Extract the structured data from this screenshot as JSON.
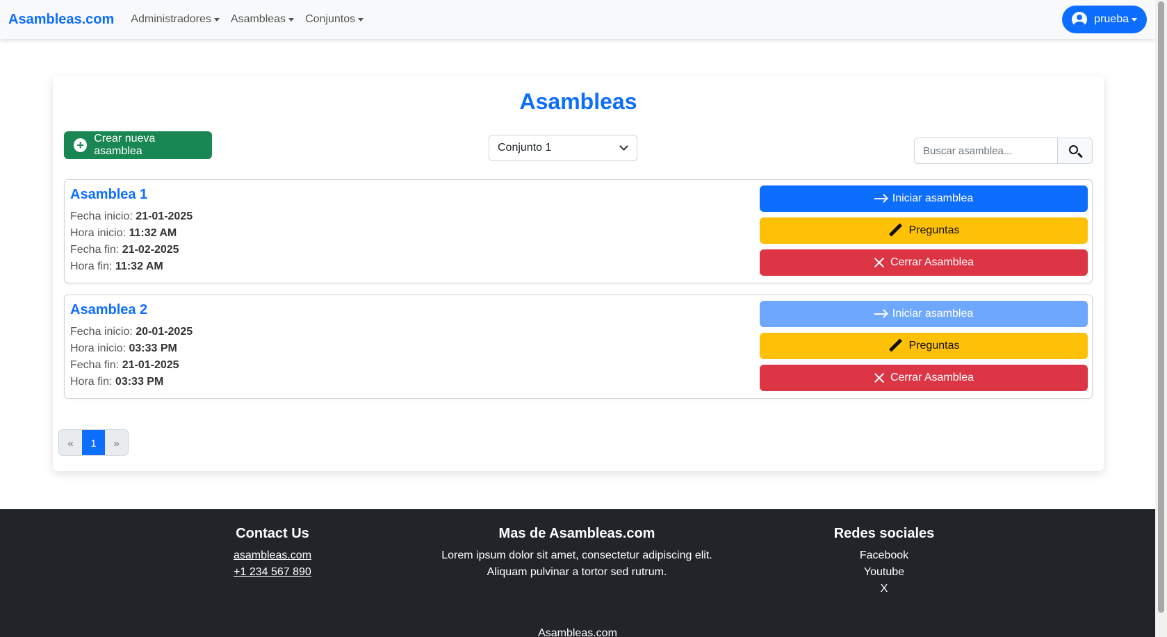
{
  "navbar": {
    "brand": "Asambleas.com",
    "menus": [
      "Administradores",
      "Asambleas",
      "Conjuntos"
    ],
    "user": "prueba"
  },
  "main": {
    "title": "Asambleas",
    "create_label": "Crear nueva asamblea",
    "conjunto_selected": "Conjunto 1",
    "search_placeholder": "Buscar asamblea...",
    "field_labels": {
      "fecha_inicio": "Fecha inicio:",
      "hora_inicio": "Hora inicio:",
      "fecha_fin": "Fecha fin:",
      "hora_fin": "Hora fin:"
    },
    "actions": {
      "start": "Iniciar asamblea",
      "questions": "Preguntas",
      "close": "Cerrar Asamblea"
    },
    "assemblies": [
      {
        "name": "Asamblea 1",
        "fecha_inicio": "21-01-2025",
        "hora_inicio": "11:32 AM",
        "fecha_fin": "21-02-2025",
        "hora_fin": "11:32 AM",
        "start_enabled": true
      },
      {
        "name": "Asamblea 2",
        "fecha_inicio": "20-01-2025",
        "hora_inicio": "03:33 PM",
        "fecha_fin": "21-01-2025",
        "hora_fin": "03:33 PM",
        "start_enabled": false
      }
    ],
    "pagination": {
      "prev": "«",
      "current": "1",
      "next": "»"
    }
  },
  "footer": {
    "contact": {
      "title": "Contact Us",
      "site": "asambleas.com",
      "phone": "+1 234 567 890"
    },
    "more": {
      "title": "Mas de Asambleas.com",
      "line1": "Lorem ipsum dolor sit amet, consectetur adipiscing elit.",
      "line2": "Aliquam pulvinar a tortor sed rutrum."
    },
    "social": {
      "title": "Redes sociales",
      "items": [
        "Facebook",
        "Youtube",
        "X"
      ]
    },
    "copyright": "Asambleas.com"
  },
  "colors": {
    "primary": "#0d6efd",
    "success": "#198754",
    "warning": "#ffc107",
    "danger": "#dc3545",
    "footer": "#212529"
  }
}
